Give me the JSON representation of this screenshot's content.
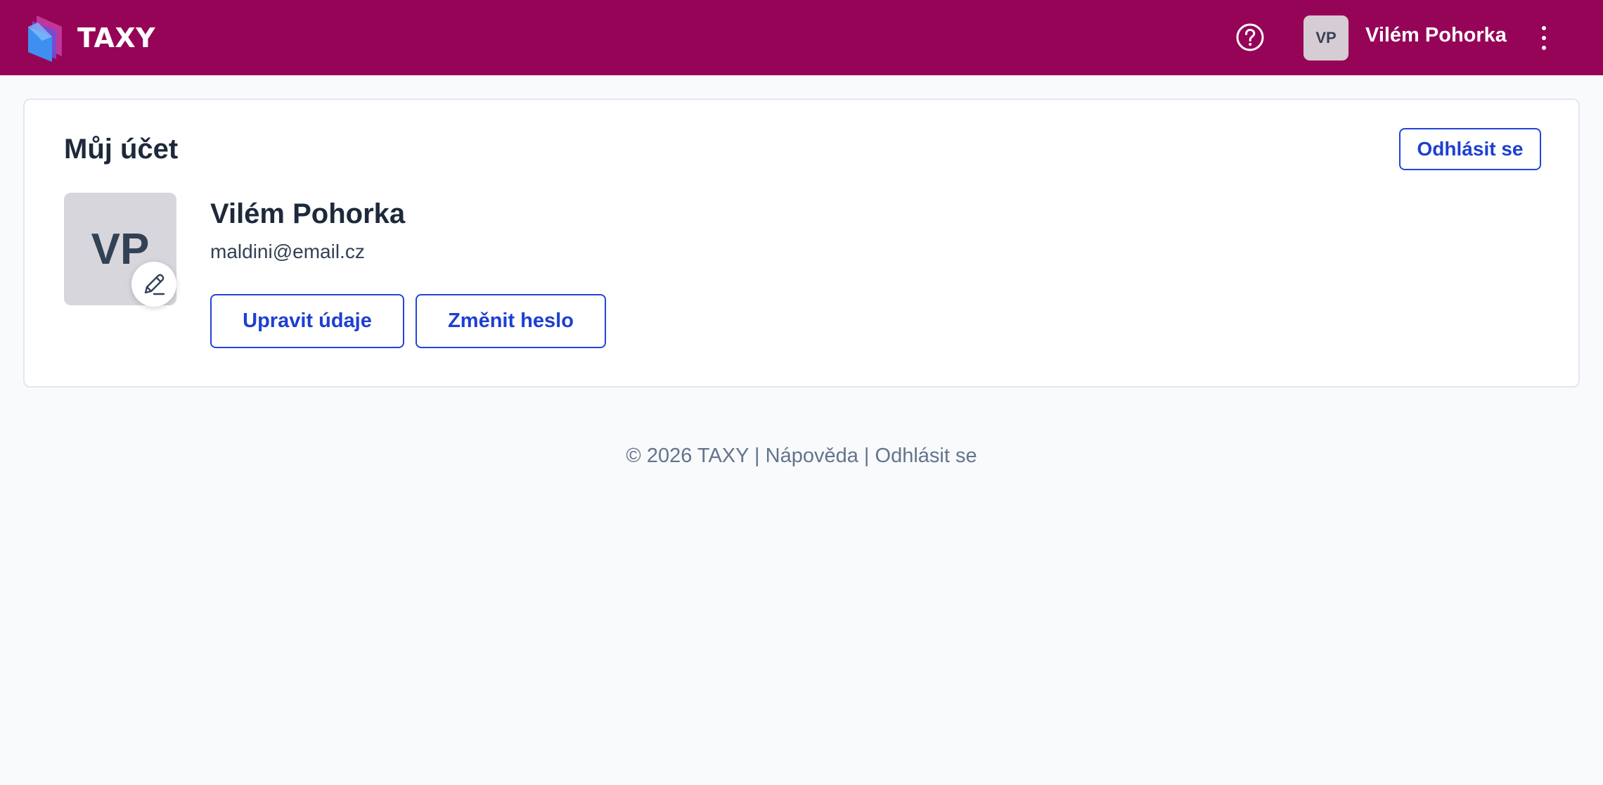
{
  "app": {
    "brand_name": "TAXY"
  },
  "header": {
    "help_icon": "question-circle-icon",
    "user_initials": "VP",
    "user_name": "Vilém Pohorka",
    "menu_icon": "kebab-menu-icon"
  },
  "account": {
    "title": "Můj účet",
    "logout_label": "Odhlásit se",
    "avatar_initials": "VP",
    "avatar_edit_icon": "pencil-icon",
    "name": "Vilém Pohorka",
    "email": "maldini@email.cz",
    "edit_label": "Upravit údaje",
    "change_password_label": "Změnit heslo"
  },
  "footer": {
    "copyright": "© 2026 TAXY",
    "separator": "|",
    "help_link": "Nápověda",
    "logout_link": "Odhlásit se"
  },
  "colors": {
    "topbar": "#960457",
    "accent": "#1d3fd1",
    "background": "#f8fafc"
  }
}
